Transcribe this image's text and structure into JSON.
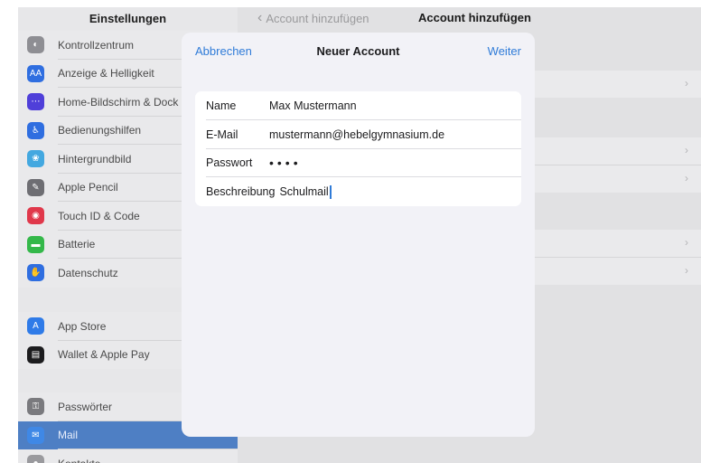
{
  "sidebar": {
    "title": "Einstellungen",
    "group1": [
      {
        "label": "Kontrollzentrum",
        "icon": "control-center-icon",
        "color": "#8e8e93",
        "glyph": "◐"
      },
      {
        "label": "Anzeige & Helligkeit",
        "icon": "display-brightness-icon",
        "color": "#2f6ee0",
        "glyph": "AA"
      },
      {
        "label": "Home-Bildschirm & Dock",
        "icon": "home-screen-icon",
        "color": "#4f3fd9",
        "glyph": "⋯"
      },
      {
        "label": "Bedienungshilfen",
        "icon": "accessibility-icon",
        "color": "#2f6ee0",
        "glyph": "♿"
      },
      {
        "label": "Hintergrundbild",
        "icon": "wallpaper-icon",
        "color": "#43a8e0",
        "glyph": "❀"
      },
      {
        "label": "Apple Pencil",
        "icon": "apple-pencil-icon",
        "color": "#6e6e73",
        "glyph": "✎"
      },
      {
        "label": "Touch ID & Code",
        "icon": "fingerprint-icon",
        "color": "#e0384b",
        "glyph": "◉"
      },
      {
        "label": "Batterie",
        "icon": "battery-icon",
        "color": "#34b84a",
        "glyph": "▬"
      },
      {
        "label": "Datenschutz",
        "icon": "privacy-hand-icon",
        "color": "#2f6ee0",
        "glyph": "✋"
      }
    ],
    "group2": [
      {
        "label": "App Store",
        "icon": "app-store-icon",
        "color": "#2f7be8",
        "glyph": "A"
      },
      {
        "label": "Wallet & Apple Pay",
        "icon": "wallet-icon",
        "color": "#1c1c1e",
        "glyph": "▤"
      }
    ],
    "group3": [
      {
        "label": "Passwörter",
        "icon": "key-icon",
        "color": "#7a7a7e",
        "glyph": "⚿"
      },
      {
        "label": "Mail",
        "icon": "mail-icon",
        "color": "#3f88e6",
        "glyph": "✉"
      },
      {
        "label": "Kontakte",
        "icon": "contacts-icon",
        "color": "#9a9a9e",
        "glyph": "●"
      }
    ]
  },
  "detail": {
    "back_label": "Account hinzufügen",
    "title": "Account hinzufügen"
  },
  "modal": {
    "cancel_label": "Abbrechen",
    "title": "Neuer Account",
    "next_label": "Weiter",
    "fields": {
      "name_label": "Name",
      "name_value": "Max Mustermann",
      "email_label": "E-Mail",
      "email_value": "mustermann@hebelgymnasium.de",
      "password_label": "Passwort",
      "password_value": "••••",
      "description_label": "Beschreibung",
      "description_value": "Schulmail"
    }
  }
}
